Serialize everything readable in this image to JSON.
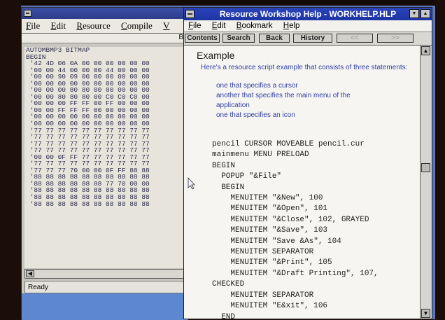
{
  "editor": {
    "menu": [
      "File",
      "Edit",
      "Resource",
      "Compile",
      "V"
    ],
    "subbar_text": "BI",
    "code_lines": [
      "AUTOMBMP3 BITMAP",
      "BEGIN",
      " '42 4D 06 0A 00 00 00 00 00 00",
      " '00 00 44 00 00 00 44 00 00 00",
      " '00 00 90 09 00 00 00 00 00 00",
      " '00 00 00 00 00 00 00 00 00 00",
      " '00 00 00 80 80 00 80 00 00 00",
      " '00 00 80 80 80 00 C0 C0 C0 00",
      " '00 00 00 FF FF 00 FF 00 00 00",
      " '00 00 FF FF FF 00 00 00 00 00",
      " '00 00 00 00 00 00 00 00 00 00",
      " '00 00 00 00 00 00 00 00 00 00",
      " '77 77 77 77 77 77 77 77 77 77",
      " '77 77 77 77 77 77 77 77 77 77",
      " '77 77 77 77 77 77 77 77 77 77",
      " '77 77 77 77 77 77 77 77 77 77",
      " '00 00 0F FF 77 77 77 77 77 77",
      " '77 77 77 77 77 77 77 77 77 77",
      " '77 77 77 70 00 00 0F FF 88 88",
      " '88 88 88 88 88 88 88 88 88 88",
      " '88 88 88 88 88 88 77 70 00 00",
      " '88 88 88 88 88 88 88 88 88 88",
      " '88 88 88 88 88 88 88 88 88 88",
      " '88 88 88 88 88 88 88 88 88 88"
    ],
    "status": "Ready"
  },
  "help": {
    "title": "Resource Workshop Help - WORKHELP.HLP",
    "menu": [
      "File",
      "Edit",
      "Bookmark",
      "Help"
    ],
    "buttons": {
      "contents": "Contents",
      "search": "Search",
      "back": "Back",
      "history": "History",
      "prev": "<<",
      "next": ">>"
    },
    "heading": "Example",
    "intro": "Here's a resource script example that consists of three statements:",
    "bullets": [
      "one that specifies a cursor",
      "another that specifies the main menu of the",
      "application",
      "one that specifies an icon"
    ],
    "code": [
      "pencil CURSOR MOVEABLE pencil.cur",
      "mainmenu MENU PRELOAD",
      "BEGIN",
      "  POPUP \"&File\"",
      "  BEGIN",
      "    MENUITEM \"&New\", 100",
      "    MENUITEM \"&Open\", 101",
      "    MENUITEM \"&Close\", 102, GRAYED",
      "    MENUITEM \"&Save\", 103",
      "    MENUITEM \"Save &As\", 104",
      "    MENUITEM SEPARATOR",
      "    MENUITEM \"&Print\", 105",
      "    MENUITEM \"&Draft Printing\", 107,",
      "CHECKED",
      "    MENUITEM SEPARATOR",
      "    MENUITEM \"E&xit\", 106",
      "  END"
    ]
  }
}
